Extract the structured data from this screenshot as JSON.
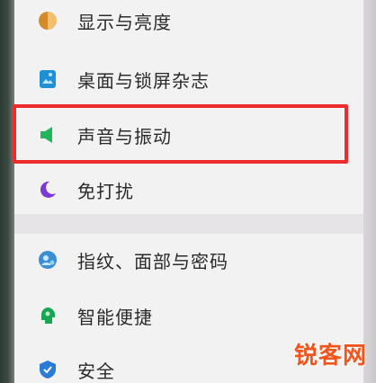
{
  "settings": {
    "items": [
      {
        "label": "显示与亮度",
        "icon": "display-brightness-icon"
      },
      {
        "label": "桌面与锁屏杂志",
        "icon": "wallpaper-icon"
      },
      {
        "label": "声音与振动",
        "icon": "sound-vibration-icon"
      },
      {
        "label": "免打扰",
        "icon": "do-not-disturb-icon"
      },
      {
        "label": "指纹、面部与密码",
        "icon": "fingerprint-face-password-icon"
      },
      {
        "label": "智能便捷",
        "icon": "smart-assist-icon"
      },
      {
        "label": "安全",
        "icon": "security-icon"
      }
    ]
  },
  "highlight": {
    "target": "声音与振动",
    "color": "#ee2c2c"
  },
  "watermark": {
    "text": "锐客网",
    "color": "#f0551e"
  },
  "colors": {
    "background": "#f3f2f3",
    "text": "#2a2a2a",
    "display_icon": "#d58a2a",
    "wallpaper_icon": "#1f8fd6",
    "sound_icon": "#22b55a",
    "dnd_icon": "#7a3ad6",
    "fingerprint_icon": "#3a8ed6",
    "smart_icon": "#19a653",
    "security_icon": "#2a7ad6"
  }
}
